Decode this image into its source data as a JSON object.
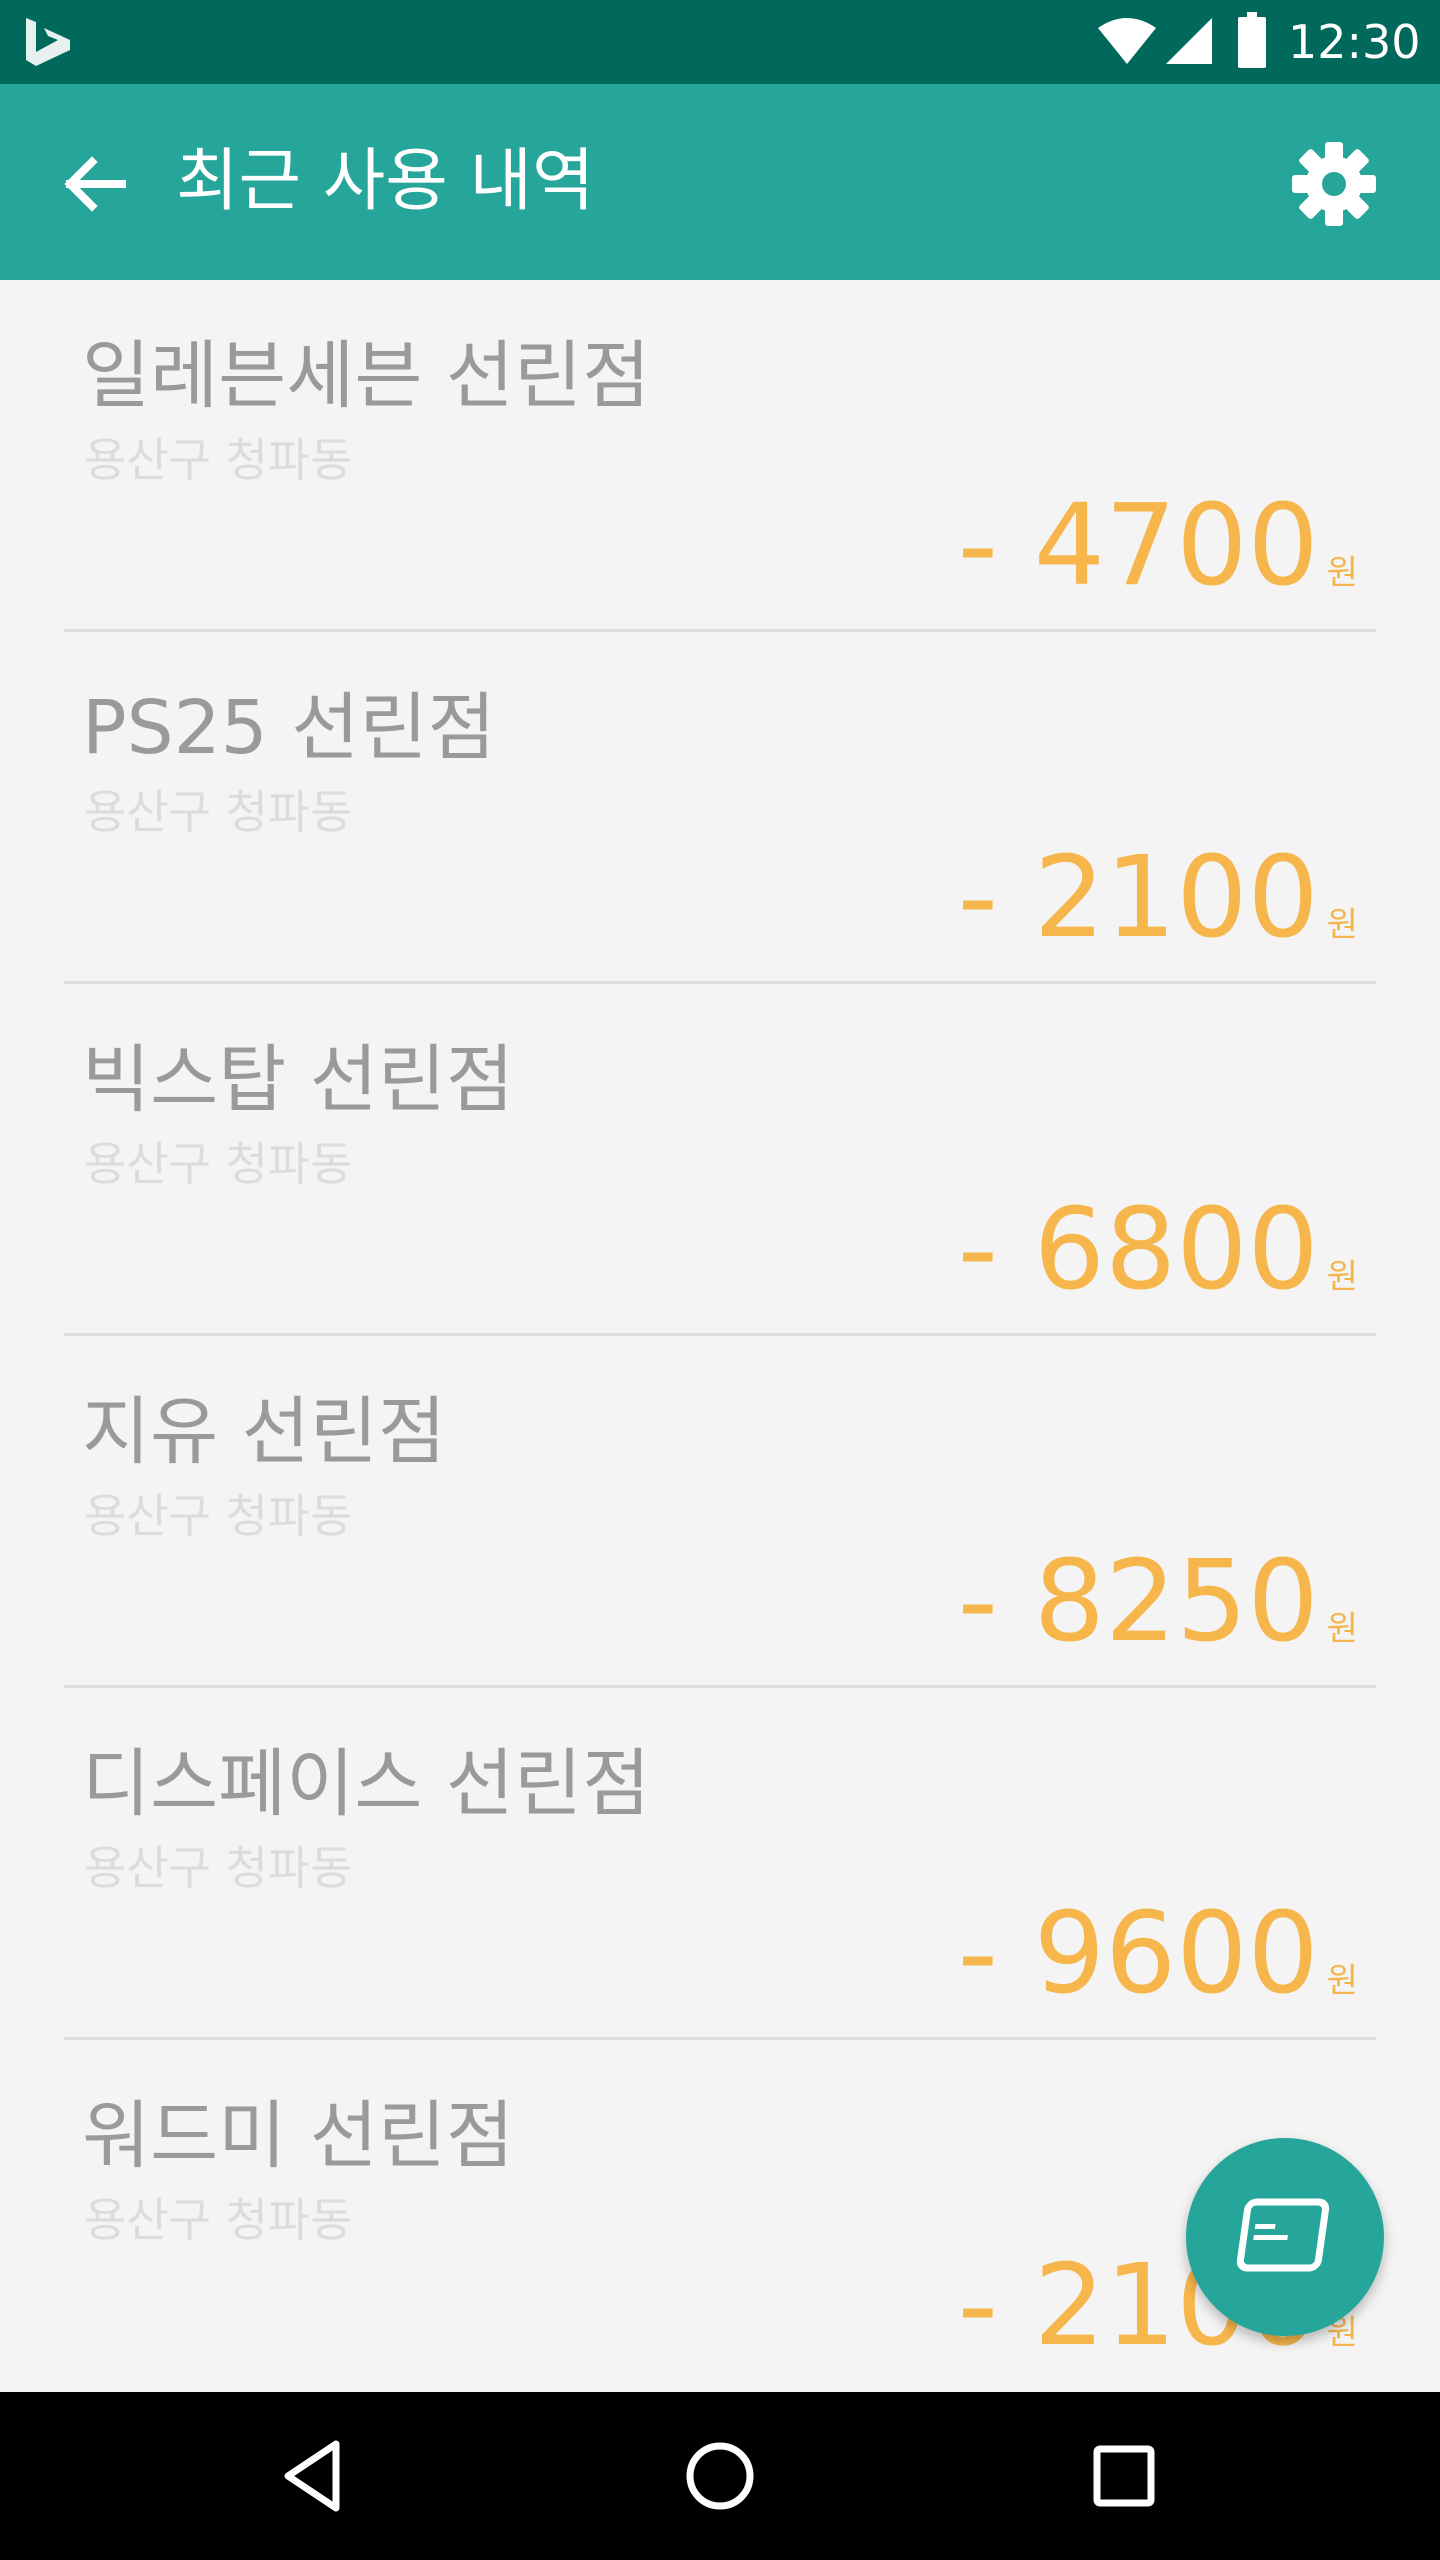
{
  "status_bar": {
    "time": "12:30",
    "icons": [
      "bing-logo",
      "wifi-icon",
      "signal-icon",
      "battery-icon"
    ]
  },
  "app_bar": {
    "title": "최근 사용 내역",
    "back_icon": "arrow-back-icon",
    "settings_icon": "gear-icon"
  },
  "transactions": [
    {
      "store": "일레븐세븐 선린점",
      "address": "용산구 청파동",
      "amount": "- 4700",
      "unit": "원"
    },
    {
      "store": "PS25 선린점",
      "address": "용산구 청파동",
      "amount": "- 2100",
      "unit": "원"
    },
    {
      "store": "빅스탑 선린점",
      "address": "용산구 청파동",
      "amount": "- 6800",
      "unit": "원"
    },
    {
      "store": "지유 선린점",
      "address": "용산구 청파동",
      "amount": "- 8250",
      "unit": "원"
    },
    {
      "store": "디스페이스 선린점",
      "address": "용산구 청파동",
      "amount": "- 9600",
      "unit": "원"
    },
    {
      "store": "워드미 선린점",
      "address": "용산구 청파동",
      "amount": "- 2100",
      "unit": "원"
    }
  ],
  "fab": {
    "icon": "credit-card-icon"
  },
  "nav_bar": {
    "icons": [
      "back-triangle-icon",
      "home-circle-icon",
      "recents-square-icon"
    ]
  },
  "colors": {
    "status_bar": "#00695c",
    "app_bar": "#26a69a",
    "amount": "#f7b64c",
    "background": "#f4f4f4"
  }
}
